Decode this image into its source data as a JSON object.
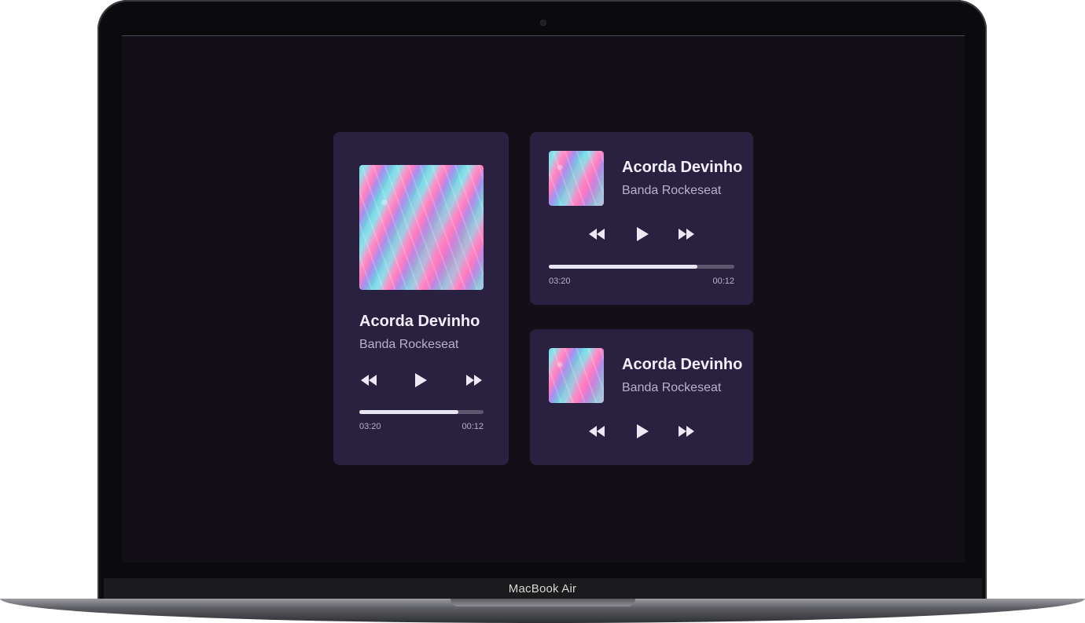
{
  "device": {
    "label": "MacBook Air"
  },
  "players": [
    {
      "title": "Acorda Devinho",
      "artist": "Banda Rockeseat",
      "elapsed": "03:20",
      "remaining": "00:12",
      "progress": 0.8
    },
    {
      "title": "Acorda Devinho",
      "artist": "Banda Rockeseat",
      "elapsed": "03:20",
      "remaining": "00:12",
      "progress": 0.8
    },
    {
      "title": "Acorda Devinho",
      "artist": "Banda Rockeseat"
    }
  ],
  "icons": {
    "previous": "rewind-icon",
    "play": "play-icon",
    "next": "fast-forward-icon"
  },
  "colors": {
    "screen_bg": "#121016",
    "card_bg": "#2a2140",
    "title": "#f1effa",
    "artist": "#b8b2cc",
    "progress_fill": "#e9e6f3",
    "progress_track": "#5d5770"
  }
}
